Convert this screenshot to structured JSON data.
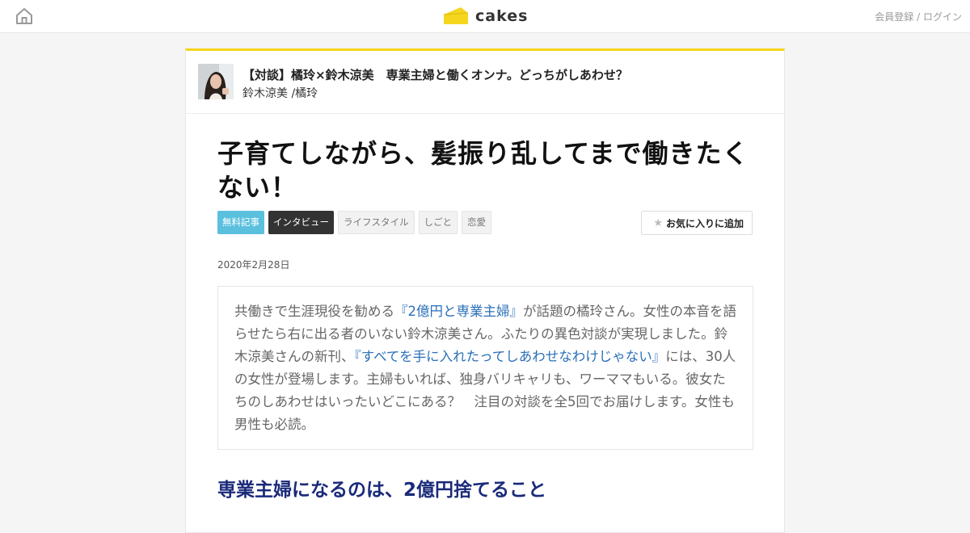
{
  "header": {
    "home_icon": "home-icon",
    "logo_text": "cakes",
    "logo_color": "#f5d51e",
    "auth_register": "会員登録",
    "auth_separator": " / ",
    "auth_login": "ログイン"
  },
  "series": {
    "title": "【対談】橘玲×鈴木涼美　専業主婦と働くオンナ。どっちがしあわせ？",
    "authors": "鈴木涼美 /橘玲"
  },
  "article": {
    "title": "子育てしながら、髪振り乱してまで働きたくない！",
    "tags": [
      "無料記事",
      "インタビュー",
      "ライフスタイル",
      "しごと",
      "恋愛"
    ],
    "favorite_label": "お気に入りに追加",
    "favorite_icon": "star-icon",
    "date": "2020年2月28日",
    "lead": {
      "p1": "共働きで生涯現役を勧める",
      "link1": "『2億円と専業主婦』",
      "p2": "が話題の橘玲さん。女性の本音を語らせたら右に出る者のいない鈴木涼美さん。ふたりの異色対談が実現しました。鈴木涼美さんの新刊、",
      "link2": "『すべてを手に入れたってしあわせなわけじゃない』",
      "p3": "には、30人の女性が登場します。主婦もいれば、独身バリキャリも、ワーママもいる。彼女たちのしあわせはいったいどこにある？　注目の対談を全5回でお届けします。女性も男性も必読。"
    },
    "subheading": "専業主婦になるのは、2億円捨てること"
  },
  "colors": {
    "accent_yellow": "#f5d51e",
    "tag_free": "#5bc0de",
    "tag_dark": "#333333",
    "link": "#2a6fb8",
    "subheading": "#1a2a7a"
  }
}
